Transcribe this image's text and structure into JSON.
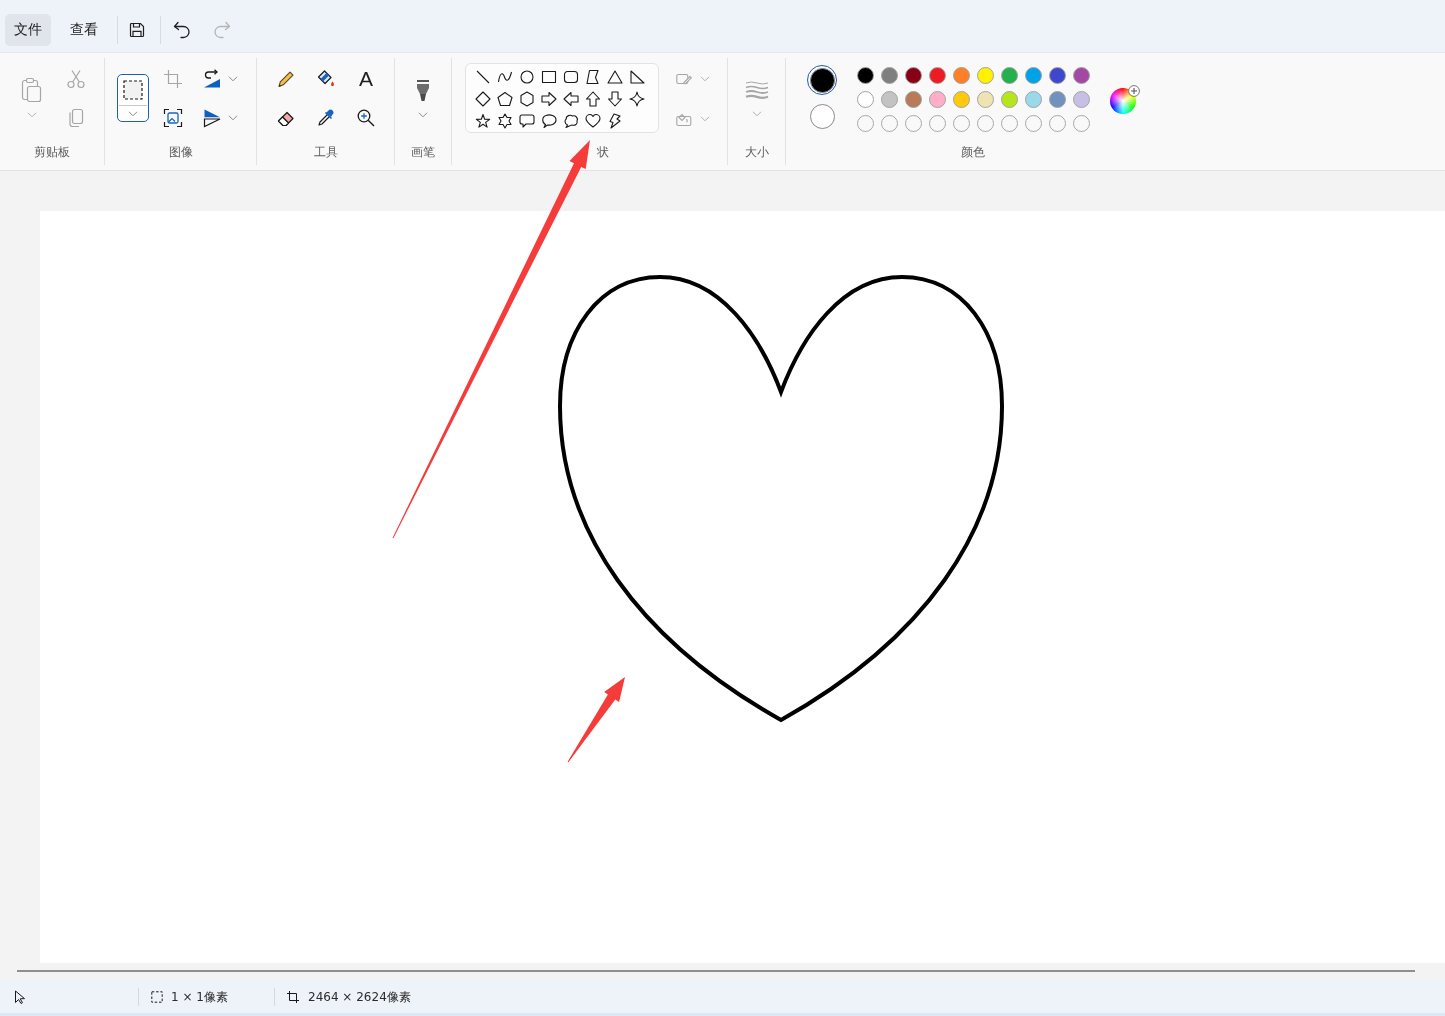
{
  "menu_bar": {
    "tabs": [
      {
        "label": "文件",
        "selected": true
      },
      {
        "label": "查看",
        "selected": false
      }
    ],
    "quick_actions": [
      {
        "kind": "save",
        "disabled": false
      },
      {
        "kind": "undo",
        "disabled": false
      },
      {
        "kind": "redo",
        "disabled": true
      }
    ]
  },
  "ribbon": {
    "clipboard": {
      "label": "剪贴板",
      "disabled": true
    },
    "image": {
      "label": "图像",
      "select_selected": true,
      "crop_disabled": true
    },
    "tools": {
      "label": "工具",
      "text_tool": "A"
    },
    "brushes": {
      "label": "画笔"
    },
    "shapes": {
      "label": "状",
      "style_disabled": true
    },
    "size": {
      "label": "大小",
      "disabled": true
    },
    "colors": {
      "label": "颜色",
      "current": [
        {
          "color": "#000000",
          "selected": true
        },
        {
          "color": "#ffffff",
          "selected": false
        }
      ],
      "palette": [
        {
          "color": "#000000"
        },
        {
          "color": "#7f7f7f"
        },
        {
          "color": "#880015"
        },
        {
          "color": "#ed1c24"
        },
        {
          "color": "#ff7f27"
        },
        {
          "color": "#fff200"
        },
        {
          "color": "#22b14c"
        },
        {
          "color": "#00a2e8"
        },
        {
          "color": "#3f48cc"
        },
        {
          "color": "#a349a4"
        },
        {
          "color": "#ffffff"
        },
        {
          "color": "#c3c3c3"
        },
        {
          "color": "#b97a57"
        },
        {
          "color": "#ffaec9"
        },
        {
          "color": "#ffc90e"
        },
        {
          "color": "#efe4b0"
        },
        {
          "color": "#b5e61d"
        },
        {
          "color": "#99d9ea"
        },
        {
          "color": "#7092be"
        },
        {
          "color": "#c8bfe7"
        }
      ],
      "custom": [
        {
          "empty": true
        },
        {
          "empty": true
        },
        {
          "empty": true
        },
        {
          "empty": true
        },
        {
          "empty": true
        },
        {
          "empty": true
        },
        {
          "empty": true
        },
        {
          "empty": true
        },
        {
          "empty": true
        },
        {
          "empty": true
        }
      ]
    }
  },
  "status_bar": {
    "selection_size": "1 × 1像素",
    "canvas_size": "2464 × 2624像素"
  }
}
